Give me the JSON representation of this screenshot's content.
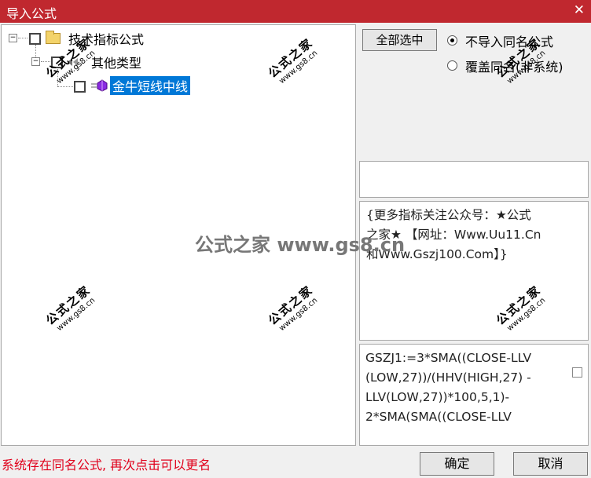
{
  "window": {
    "title": "导入公式",
    "close_glyph": "✕"
  },
  "tree": {
    "root_label": "技术指标公式",
    "category_label": "其他类型",
    "item_label": "金牛短线中线",
    "expander_glyph": "−"
  },
  "options": {
    "select_all_label": "全部选中",
    "radio_skip_label": "不导入同名公式",
    "radio_overwrite_label": "覆盖同名(非系统)",
    "selected_radio": "skip"
  },
  "info_text": "{更多指标关注公众号：★公式\n之家★ 【网址：Www.Uu11.Cn\n和Www.Gszj100.Com】}",
  "code_text": "GSZJ1:=3*SMA((CLOSE-LLV\n(LOW,27))/(HHV(HIGH,27) -\nLLV(LOW,27))*100,5,1)-\n2*SMA(SMA((CLOSE-LLV",
  "status_message": "系统存在同名公式, 再次点击可以更名",
  "buttons": {
    "ok_label": "确定",
    "cancel_label": "取消"
  },
  "watermark": {
    "small_main": "公式之家",
    "small_url": "www.gs8.cn",
    "center": "公式之家 www.gs8.cn"
  },
  "colors": {
    "titlebar": "#c0282f",
    "selection": "#0078d7",
    "status": "#e0001b"
  }
}
